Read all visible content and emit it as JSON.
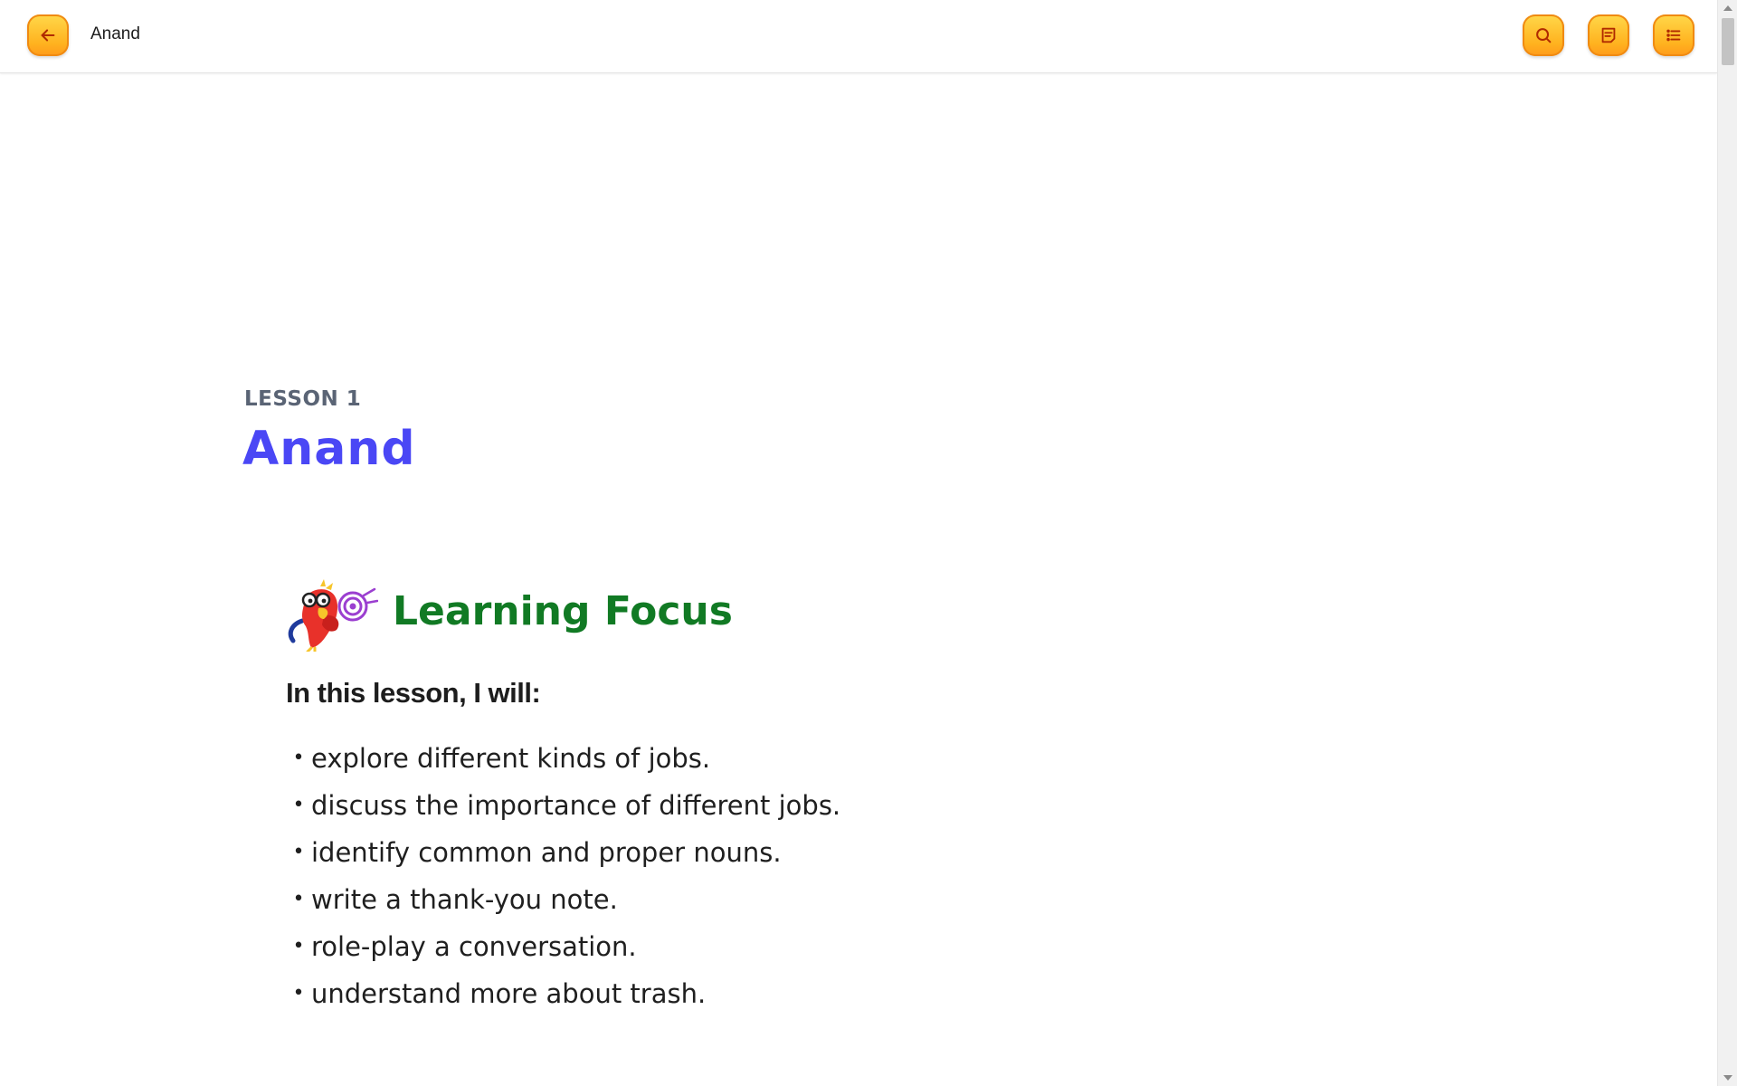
{
  "header": {
    "title": "Anand",
    "back_icon": "arrow-left-icon",
    "search_icon": "search-icon",
    "notes_icon": "notes-icon",
    "toc_icon": "list-icon",
    "button_color": "#ffb21f"
  },
  "lesson": {
    "label": "LESSON 1",
    "title": "Anand",
    "title_color": "#4a47f5"
  },
  "learning_focus": {
    "heading": "Learning Focus",
    "heading_color": "#117a24",
    "mascot_icon": "parrot-with-target-icon",
    "intro": "In this lesson, I will:",
    "bullet": "•",
    "items": [
      "explore different kinds of jobs.",
      "discuss the importance of different jobs.",
      "identify common and proper nouns.",
      "write a thank-you note.",
      "role-play a conversation.",
      "understand more about trash."
    ]
  }
}
